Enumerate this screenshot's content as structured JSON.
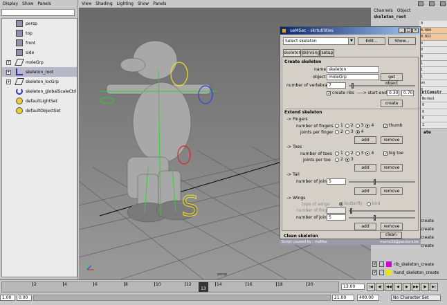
{
  "outliner": {
    "menu": [
      "Display",
      "Show",
      "Panels"
    ],
    "items": [
      {
        "label": "persp",
        "icon": "camera-icon",
        "expand": ""
      },
      {
        "label": "top",
        "icon": "camera-icon",
        "expand": ""
      },
      {
        "label": "front",
        "icon": "camera-icon",
        "expand": ""
      },
      {
        "label": "side",
        "icon": "camera-icon",
        "expand": ""
      },
      {
        "label": "moleGrp",
        "icon": "transform-icon",
        "expand": "+"
      },
      {
        "label": "skeleton_root",
        "icon": "joint-icon",
        "expand": "+"
      },
      {
        "label": "skeleton_locGrp",
        "icon": "transform-icon",
        "expand": "+"
      },
      {
        "label": "skeleton_globalScaleCtrl",
        "icon": "curve-icon",
        "expand": ""
      },
      {
        "label": "defaultLightSet",
        "icon": "set-icon",
        "expand": ""
      },
      {
        "label": "defaultObjectSet",
        "icon": "set-icon",
        "expand": ""
      }
    ]
  },
  "viewport": {
    "menu": [
      "View",
      "Shading",
      "Lighting",
      "Show",
      "Panels"
    ],
    "camera_label": "persp"
  },
  "channels": {
    "menu": [
      "Channels",
      "Object"
    ],
    "title": "skeleton_root",
    "values": [
      "0",
      "0.084",
      "0.022",
      "0",
      "0",
      "0",
      "1",
      "1",
      "1",
      "on",
      "0",
      "1",
      "0"
    ],
    "org_rows": [
      1,
      2
    ],
    "constraint": "intConstr",
    "normal": "Normal",
    "vals2": [
      "0",
      "0",
      "0",
      "1"
    ],
    "ate": "ate"
  },
  "layers": {
    "items": [
      {
        "flag": "V",
        "color": "#d000d0",
        "label": "rib_skeleton_create"
      },
      {
        "flag": "V",
        "color": "#e8e800",
        "label": "hand_skeleton_create"
      }
    ],
    "partial": [
      "create",
      "create",
      "create",
      "create"
    ]
  },
  "dialog": {
    "title": "ueMSec - skrtutilities",
    "select": "Select skeleton",
    "edit": "Edit...",
    "show": "Show...",
    "tabs": [
      "skeleton",
      "skinning",
      "setup"
    ],
    "create": {
      "heading": "Create skeleton",
      "name_label": "name",
      "name_value": "skeleton",
      "object_label": "object",
      "object_value": "moleGrp",
      "get_object": "get object",
      "vertebrae_label": "number of vertebrae",
      "vertebrae_value": "7",
      "ribs_label": "create ribs",
      "start_end_label": "----> start-end",
      "start_value": "0.30",
      "end_value": "0.70",
      "create_btn": "create"
    },
    "extend": {
      "heading": "Extend skeleton",
      "fingers_label": "-> Fingers",
      "num_fingers": "number of fingers",
      "fingers_opts": [
        "1",
        "2",
        "3",
        "4"
      ],
      "thumb": "thumb",
      "joints_per_finger": "joints per finger",
      "jpf_opts": [
        "2",
        "3",
        "4"
      ],
      "toes_label": "-> Toes",
      "num_toes": "number of toes",
      "toes_opts": [
        "1",
        "2",
        "3",
        "4"
      ],
      "big_toe": "big toe",
      "joints_per_toe": "joints per toe",
      "jpt_opts": [
        "2",
        "3"
      ],
      "tail_label": "-> Tail",
      "num_joints": "number of joints",
      "tail_value": "5",
      "wings_label": "-> Wings",
      "type_of_wings": "type of wings",
      "wing_types": [
        "butterfly",
        "bird"
      ],
      "num_fingers_w": "number of fingers",
      "wings_joints": "number of joints",
      "wings_value": "5",
      "add": "add",
      "remove": "remove"
    },
    "clean": {
      "heading": "Clean skeleton",
      "btn": "clean"
    },
    "footer_left": "Script created by : maMse",
    "footer_right": "mame3d@pandora.be"
  },
  "timeline": {
    "ticks": [
      "2",
      "4",
      "6",
      "8",
      "10",
      "12",
      "14",
      "16",
      "18",
      "20"
    ],
    "current_frame": "13",
    "frame_field": "13.00",
    "start": "1.00",
    "start2": "0.00",
    "range_end": "21.00",
    "end": "400.00",
    "char_set": "No Character Set"
  }
}
